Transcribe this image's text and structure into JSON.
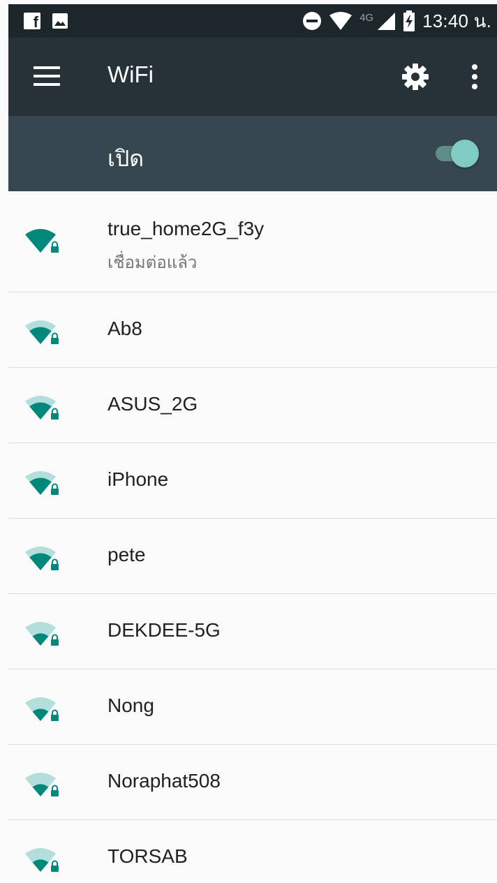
{
  "status_bar": {
    "left_icons": [
      "facebook-icon",
      "gallery-icon"
    ],
    "right_icons": [
      "do-not-disturb-icon",
      "wifi-signal-icon",
      "cell-signal-icon",
      "battery-charging-icon"
    ],
    "network_type": "4G",
    "time": "13:40 น."
  },
  "app_bar": {
    "title": "WiFi",
    "menu_icon": "menu-icon",
    "settings_icon": "gear-icon",
    "overflow_icon": "more-vert-icon"
  },
  "wifi_toggle": {
    "label": "เปิด",
    "on": true
  },
  "colors": {
    "status_bar": "#1d262a",
    "app_bar": "#263238",
    "toggle_row": "#37474f",
    "accent": "#80cbc4",
    "wifi_strong": "#00897b",
    "wifi_weak": "#b2dfdb",
    "list_bg": "#fafafa"
  },
  "networks": [
    {
      "name": "true_home2G_f3y",
      "status": "เชื่อมต่อแล้ว",
      "signal_bars": 4,
      "secured": true,
      "icon": "wifi-lock-icon"
    },
    {
      "name": "Ab8",
      "signal_bars": 3,
      "secured": true,
      "icon": "wifi-lock-icon"
    },
    {
      "name": "ASUS_2G",
      "signal_bars": 3,
      "secured": true,
      "icon": "wifi-lock-icon"
    },
    {
      "name": "iPhone",
      "signal_bars": 3,
      "secured": true,
      "icon": "wifi-lock-icon"
    },
    {
      "name": "pete",
      "signal_bars": 3,
      "secured": true,
      "icon": "wifi-lock-icon"
    },
    {
      "name": "DEKDEE-5G",
      "signal_bars": 2,
      "secured": true,
      "icon": "wifi-lock-icon"
    },
    {
      "name": "Nong",
      "signal_bars": 2,
      "secured": true,
      "icon": "wifi-lock-icon"
    },
    {
      "name": "Noraphat508",
      "signal_bars": 2,
      "secured": true,
      "icon": "wifi-lock-icon"
    },
    {
      "name": "TORSAB",
      "signal_bars": 2,
      "secured": true,
      "icon": "wifi-lock-icon"
    }
  ]
}
